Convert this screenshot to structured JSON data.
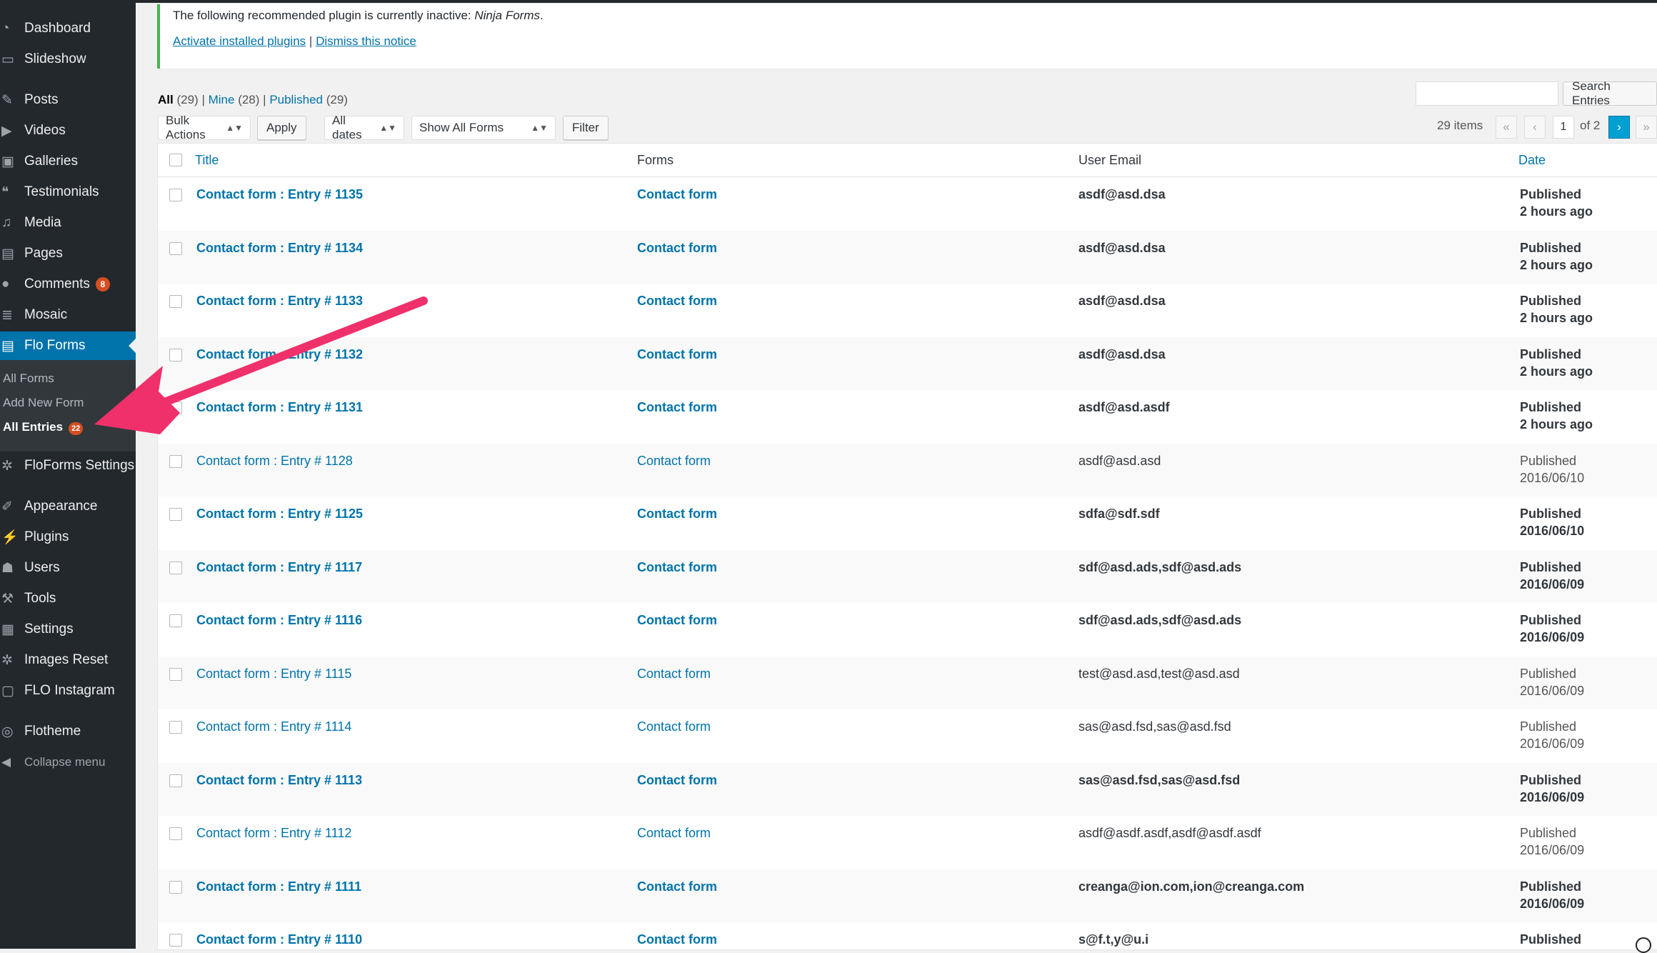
{
  "sidebar": {
    "items": [
      {
        "label": "Dashboard",
        "icon": "dashboard-icon"
      },
      {
        "label": "Slideshow",
        "icon": "slideshow-icon"
      },
      {
        "label": "Posts",
        "icon": "pin-icon"
      },
      {
        "label": "Videos",
        "icon": "video-icon"
      },
      {
        "label": "Galleries",
        "icon": "gallery-icon"
      },
      {
        "label": "Testimonials",
        "icon": "quote-icon"
      },
      {
        "label": "Media",
        "icon": "media-icon"
      },
      {
        "label": "Pages",
        "icon": "page-icon"
      },
      {
        "label": "Comments",
        "icon": "comment-icon",
        "badge": "8"
      },
      {
        "label": "Mosaic",
        "icon": "mosaic-icon"
      },
      {
        "label": "Flo Forms",
        "icon": "form-icon"
      },
      {
        "label": "FloForms Settings",
        "icon": "gear-icon"
      },
      {
        "label": "Appearance",
        "icon": "brush-icon"
      },
      {
        "label": "Plugins",
        "icon": "plug-icon"
      },
      {
        "label": "Users",
        "icon": "user-icon"
      },
      {
        "label": "Tools",
        "icon": "wrench-icon"
      },
      {
        "label": "Settings",
        "icon": "settings-icon"
      },
      {
        "label": "Images Reset",
        "icon": "gear-icon"
      },
      {
        "label": "FLO Instagram",
        "icon": "instagram-icon"
      },
      {
        "label": "Flotheme",
        "icon": "flotheme-icon"
      }
    ],
    "submenu": [
      {
        "label": "All Forms"
      },
      {
        "label": "Add New Form"
      },
      {
        "label": "All Entries",
        "badge": "22"
      }
    ],
    "collapse_label": "Collapse menu"
  },
  "notice": {
    "message_prefix": "The following recommended plugin is currently inactive: ",
    "plugin_name": "Ninja Forms",
    "message_suffix": ".",
    "activate_link": "Activate installed plugins",
    "separator": "|",
    "dismiss_link": "Dismiss this notice"
  },
  "views": [
    {
      "label": "All",
      "count": "(29)"
    },
    {
      "label": "Mine",
      "count": "(28)"
    },
    {
      "label": "Published",
      "count": "(29)"
    }
  ],
  "views_separator": "|",
  "toolbar": {
    "bulk_actions": "Bulk Actions",
    "apply": "Apply",
    "dates": "All dates",
    "forms_filter": "Show All Forms",
    "filter": "Filter",
    "search_button": "Search Entries",
    "search_value": ""
  },
  "pagination": {
    "items": "29 items",
    "first": "«",
    "prev": "‹",
    "current": "1",
    "of": "of 2",
    "next": "›",
    "last": "»"
  },
  "table": {
    "headers": {
      "title": "Title",
      "forms": "Forms",
      "email": "User Email",
      "date": "Date"
    },
    "rows": [
      {
        "title": "Contact form : Entry # 1135",
        "form": "Contact form",
        "email": "asdf@asd.dsa",
        "status": "Published",
        "date": "2 hours ago",
        "unread": true
      },
      {
        "title": "Contact form : Entry # 1134",
        "form": "Contact form",
        "email": "asdf@asd.dsa",
        "status": "Published",
        "date": "2 hours ago",
        "unread": true
      },
      {
        "title": "Contact form : Entry # 1133",
        "form": "Contact form",
        "email": "asdf@asd.dsa",
        "status": "Published",
        "date": "2 hours ago",
        "unread": true
      },
      {
        "title": "Contact form : Entry # 1132",
        "form": "Contact form",
        "email": "asdf@asd.dsa",
        "status": "Published",
        "date": "2 hours ago",
        "unread": true
      },
      {
        "title": "Contact form : Entry # 1131",
        "form": "Contact form",
        "email": "asdf@asd.asdf",
        "status": "Published",
        "date": "2 hours ago",
        "unread": true
      },
      {
        "title": "Contact form : Entry # 1128",
        "form": "Contact form",
        "email": "asdf@asd.asd",
        "status": "Published",
        "date": "2016/06/10",
        "unread": false
      },
      {
        "title": "Contact form : Entry # 1125",
        "form": "Contact form",
        "email": "sdfa@sdf.sdf",
        "status": "Published",
        "date": "2016/06/10",
        "unread": true
      },
      {
        "title": "Contact form : Entry # 1117",
        "form": "Contact form",
        "email": "sdf@asd.ads,sdf@asd.ads",
        "status": "Published",
        "date": "2016/06/09",
        "unread": true
      },
      {
        "title": "Contact form : Entry # 1116",
        "form": "Contact form",
        "email": "sdf@asd.ads,sdf@asd.ads",
        "status": "Published",
        "date": "2016/06/09",
        "unread": true
      },
      {
        "title": "Contact form : Entry # 1115",
        "form": "Contact form",
        "email": "test@asd.asd,test@asd.asd",
        "status": "Published",
        "date": "2016/06/09",
        "unread": false
      },
      {
        "title": "Contact form : Entry # 1114",
        "form": "Contact form",
        "email": "sas@asd.fsd,sas@asd.fsd",
        "status": "Published",
        "date": "2016/06/09",
        "unread": false
      },
      {
        "title": "Contact form : Entry # 1113",
        "form": "Contact form",
        "email": "sas@asd.fsd,sas@asd.fsd",
        "status": "Published",
        "date": "2016/06/09",
        "unread": true
      },
      {
        "title": "Contact form : Entry # 1112",
        "form": "Contact form",
        "email": "asdf@asdf.asdf,asdf@asdf.asdf",
        "status": "Published",
        "date": "2016/06/09",
        "unread": false
      },
      {
        "title": "Contact form : Entry # 1111",
        "form": "Contact form",
        "email": "creanga@ion.com,ion@creanga.com",
        "status": "Published",
        "date": "2016/06/09",
        "unread": true
      },
      {
        "title": "Contact form : Entry # 1110",
        "form": "Contact form",
        "email": "s@f.t,y@u.i",
        "status": "Published",
        "date": "",
        "unread": true
      }
    ]
  },
  "colors": {
    "sidebar": "#23282d",
    "accent": "#0073aa",
    "arrow": "#f0306a",
    "notice_border": "#46b450"
  }
}
